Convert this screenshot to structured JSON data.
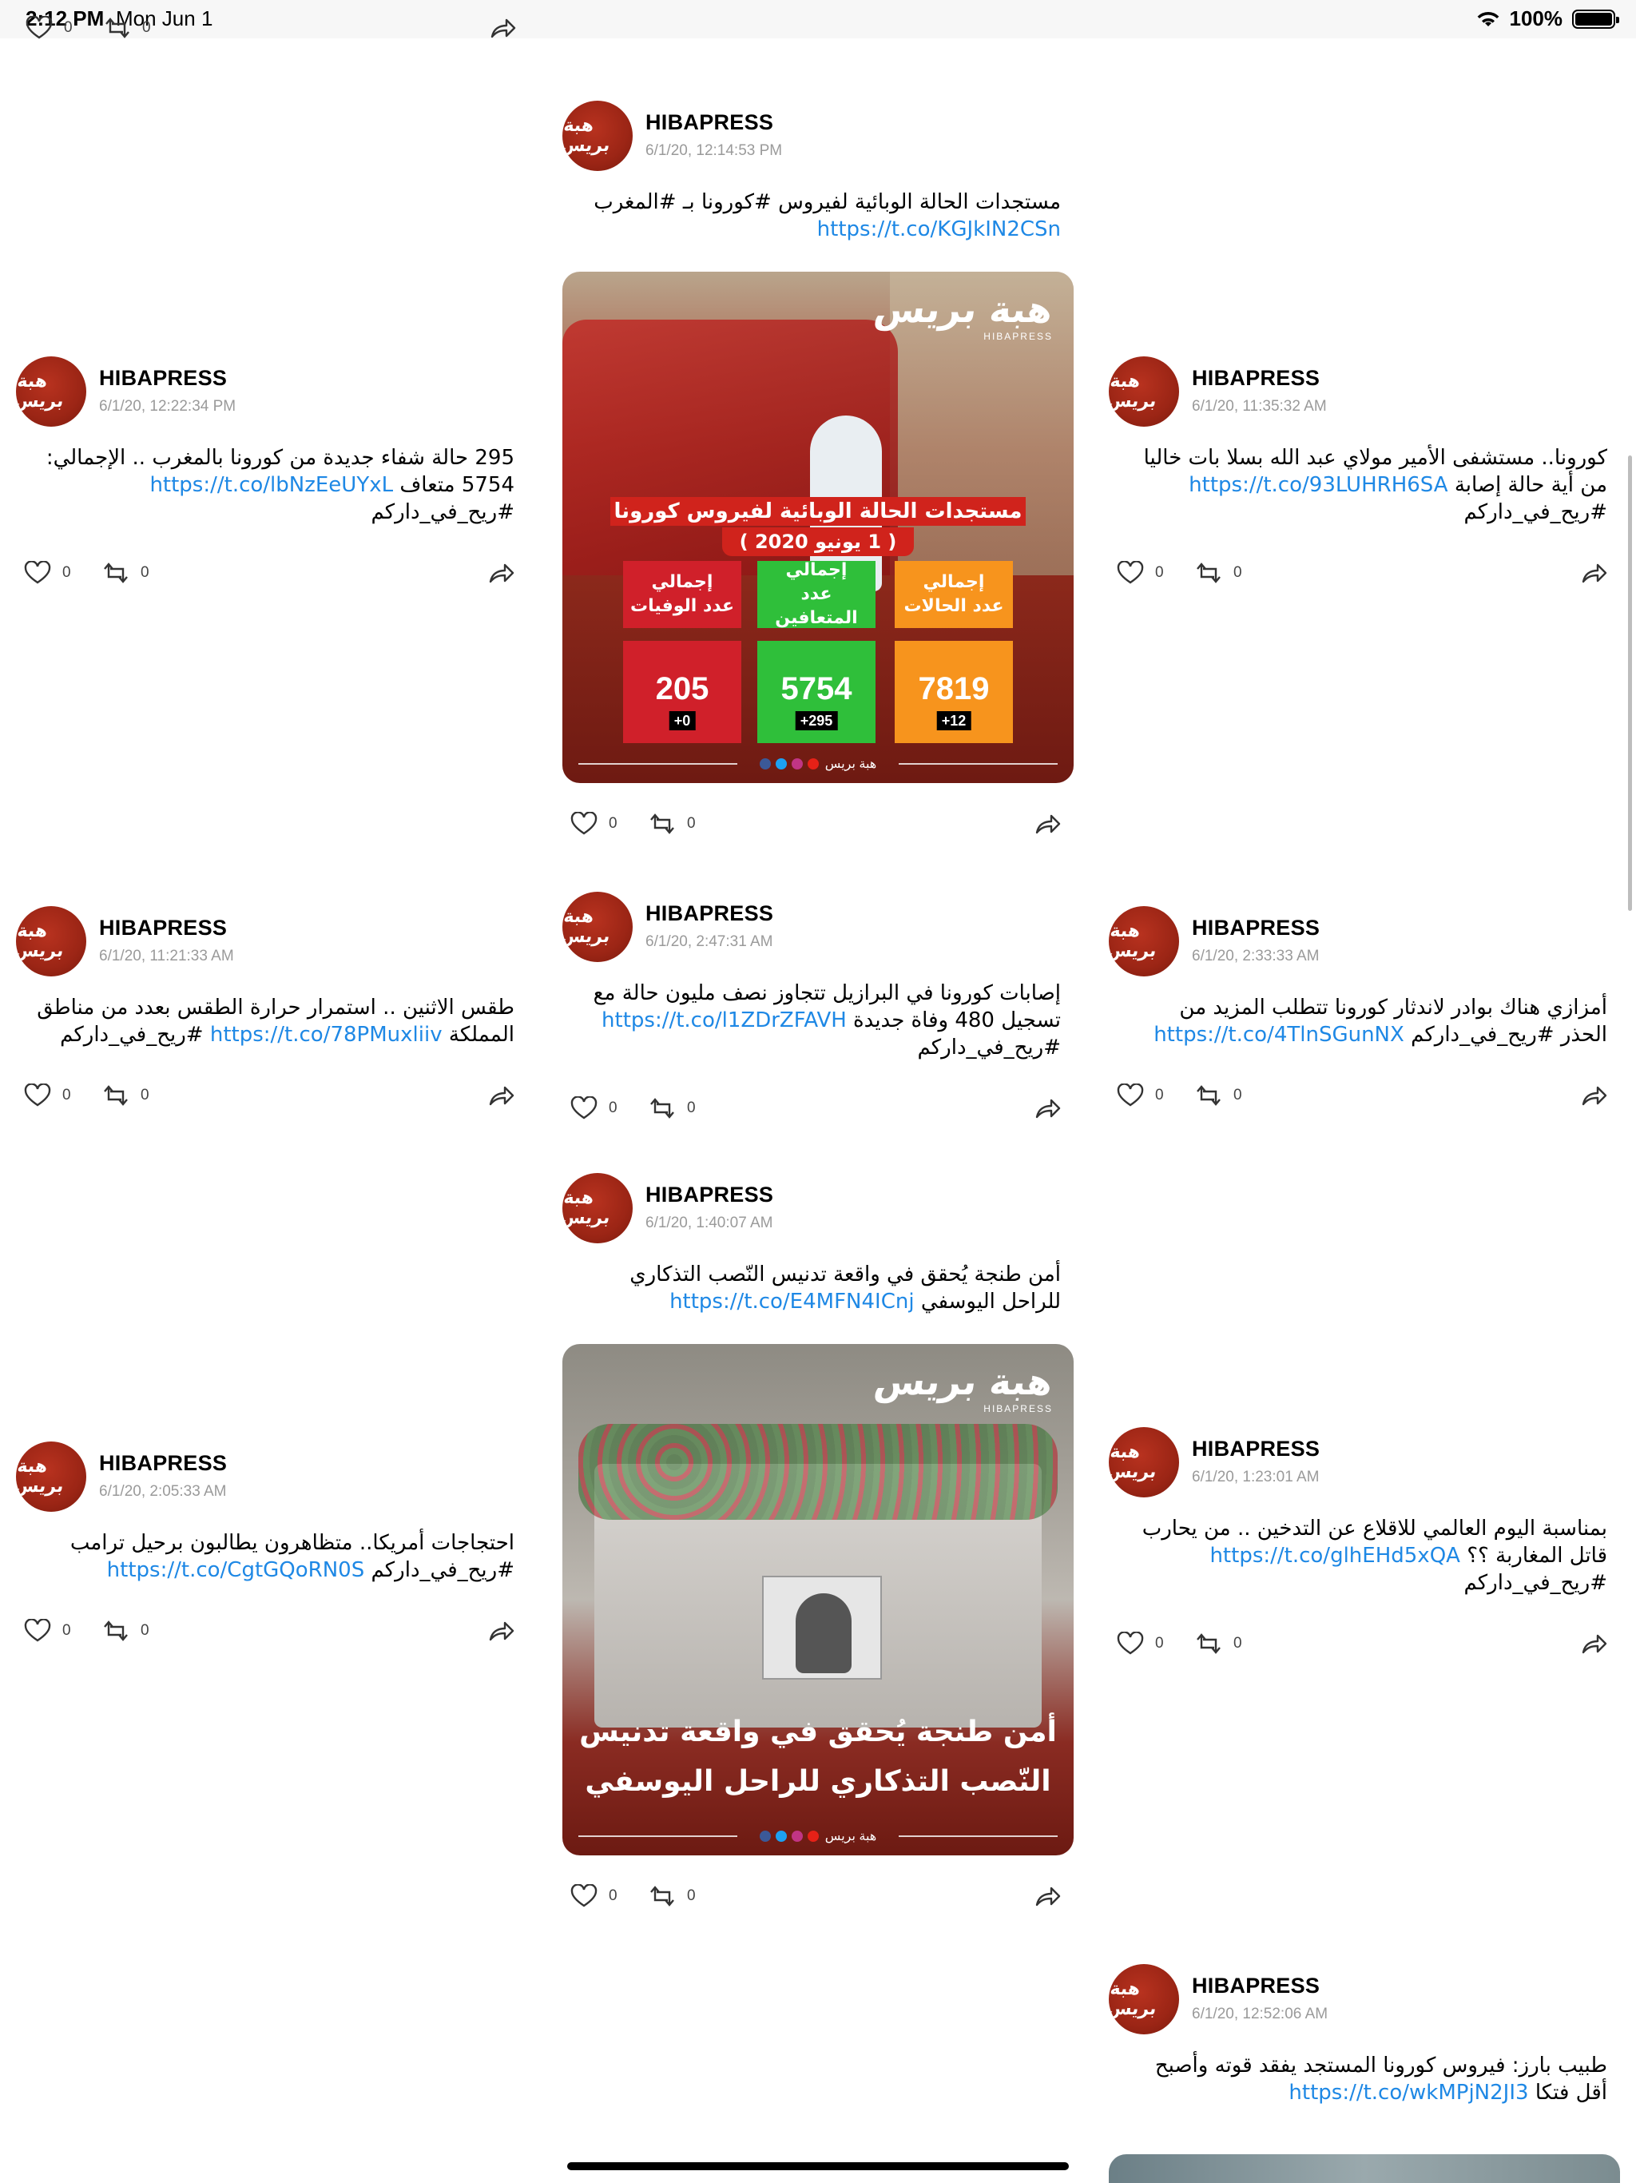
{
  "status_bar": {
    "time": "2:12 PM",
    "date": "Mon Jun 1",
    "battery": "100%"
  },
  "top_actions": {
    "likes": "0",
    "retweets": "0"
  },
  "tweets": [
    {
      "name": "HIBAPRESS",
      "time": "6/1/20, 12:14:53 PM",
      "text": "مستجدات الحالة الوبائية لفيروس #كورونا بـ #المغرب",
      "link": "https://t.co/KGJkIN2CSn",
      "text_after": "",
      "likes": "0",
      "retweets": "0"
    },
    {
      "name": "HIBAPRESS",
      "time": "6/1/20, 12:22:34 PM",
      "text": "295 حالة شفاء جديدة من كورونا بالمغرب .. الإجمالي: 5754 متعاف",
      "link": "https://t.co/lbNzEeUYxL",
      "text_after": "#ريح_في_داركم",
      "likes": "0",
      "retweets": "0"
    },
    {
      "name": "HIBAPRESS",
      "time": "6/1/20, 11:35:32 AM",
      "text": "كورونا.. مستشفى الأمير مولاي عبد الله بسلا بات خاليا من أية حالة إصابة",
      "link": "https://t.co/93LUHRH6SA",
      "text_after": "#ريح_في_داركم",
      "likes": "0",
      "retweets": "0"
    },
    {
      "name": "HIBAPRESS",
      "time": "6/1/20, 11:21:33 AM",
      "text": "طقس الاثنين .. استمرار حرارة الطقس بعدد من مناطق المملكة",
      "link": "https://t.co/78PMuxliiv",
      "text_after": "#ريح_في_داركم",
      "likes": "0",
      "retweets": "0"
    },
    {
      "name": "HIBAPRESS",
      "time": "6/1/20, 2:47:31 AM",
      "text": "إصابات كورونا في البرازيل تتجاوز نصف مليون حالة مع تسجيل 480 وفاة جديدة",
      "link": "https://t.co/l1ZDrZFAVH",
      "text_after": "#ريح_في_داركم",
      "likes": "0",
      "retweets": "0"
    },
    {
      "name": "HIBAPRESS",
      "time": "6/1/20, 2:33:33 AM",
      "text": "أمزازي هناك بوادر لاندثار كورونا تتطلب المزيد من الحذر #ريح_في_داركم",
      "link": "https://t.co/4TlnSGunNX",
      "text_after": "",
      "likes": "0",
      "retweets": "0"
    },
    {
      "name": "HIBAPRESS",
      "time": "6/1/20, 1:40:07 AM",
      "text": "أمن طنجة يُحقق في واقعة تدنيس النّصب التذكاري للراحل اليوسفي",
      "link": "https://t.co/E4MFN4ICnj",
      "text_after": "",
      "likes": "0",
      "retweets": "0"
    },
    {
      "name": "HIBAPRESS",
      "time": "6/1/20, 2:05:33 AM",
      "text": "احتجاجات أمريكا.. متظاهرون يطالبون برحيل ترامب #ريح_في_داركم",
      "link": "https://t.co/CgtGQoRN0S",
      "text_after": "",
      "likes": "0",
      "retweets": "0"
    },
    {
      "name": "HIBAPRESS",
      "time": "6/1/20, 1:23:01 AM",
      "text": "بمناسبة اليوم العالمي للاقلاع عن التدخين .. من يحارب قاتل المغاربة ؟؟",
      "link": "https://t.co/glhEHd5xQA",
      "text_after": "#ريح_في_داركم",
      "likes": "0",
      "retweets": "0"
    },
    {
      "name": "HIBAPRESS",
      "time": "6/1/20, 12:52:06 AM",
      "text": "طبيب بارز: فيروس كورونا المستجد يفقد قوته وأصبح أقل فتكا",
      "link": "https://t.co/wkMPjN2JI3",
      "text_after": "",
      "likes": "",
      "retweets": ""
    }
  ],
  "avatar_text": "هبة بريس",
  "logo": {
    "main": "هبة بريس",
    "sub": "HIBAPRESS"
  },
  "infographic": {
    "title": "مستجدات الحالة الوبائية لفيروس كورونا",
    "date": "( 1 يونيو 2020 )",
    "stats": [
      {
        "label1": "إجمالي",
        "label2": "عدد الوفيات",
        "value": "205",
        "delta": "+0",
        "color": "#d0202a"
      },
      {
        "label1": "إجمالي",
        "label2": "عدد المتعافين",
        "value": "5754",
        "delta": "+295",
        "color": "#2fbf3a"
      },
      {
        "label1": "إجمالي",
        "label2": "عدد الحالات",
        "value": "7819",
        "delta": "+12",
        "color": "#f7941d"
      }
    ]
  },
  "memorial_caption": {
    "line1": "أمن طنجة يُحقق في واقعة تدنيس",
    "line2": "النّصب التذكاري للراحل اليوسفي"
  },
  "img_footer": "هبة بريس"
}
